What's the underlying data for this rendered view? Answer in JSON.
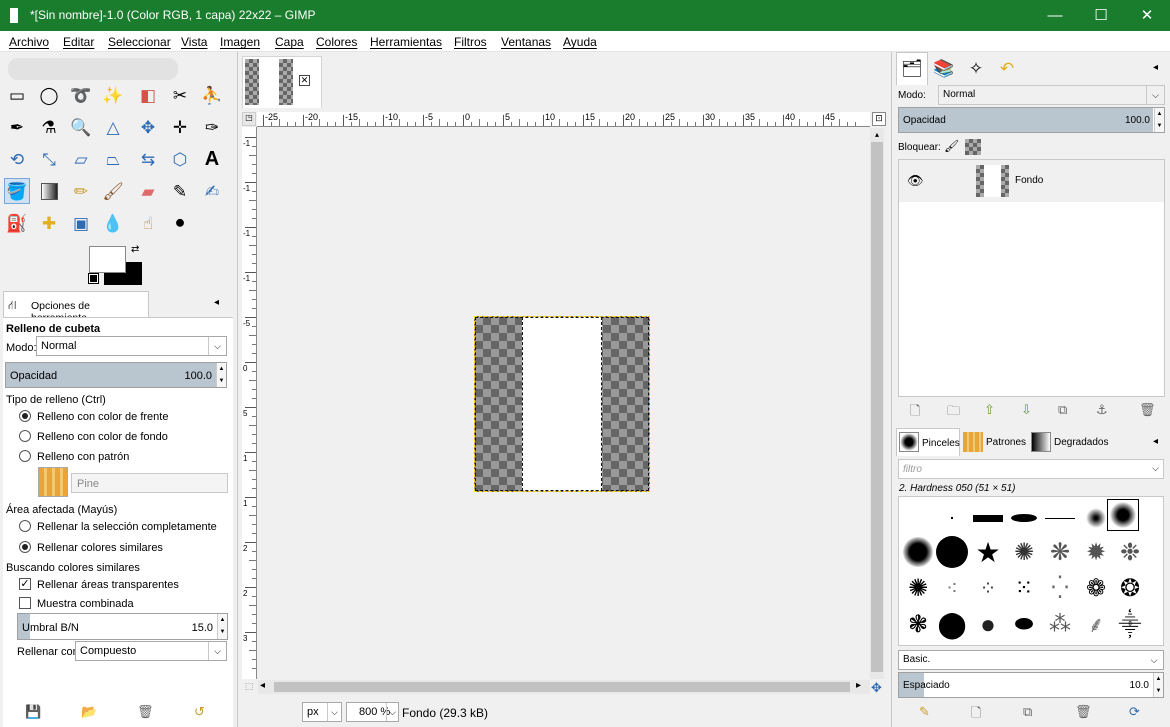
{
  "window": {
    "title": "*[Sin nombre]-1.0 (Color RGB, 1 capa) 22x22 – GIMP",
    "minimize_glyph": "—",
    "maximize_glyph": "☐",
    "close_glyph": "✕"
  },
  "menu": [
    "Archivo",
    "Editar",
    "Seleccionar",
    "Vista",
    "Imagen",
    "Capa",
    "Colores",
    "Herramientas",
    "Filtros",
    "Ventanas",
    "Ayuda"
  ],
  "tool_options": {
    "tab_label": "Opciones de herramienta",
    "tool_name": "Relleno de cubeta",
    "mode_label": "Modo:",
    "mode_value": "Normal",
    "opacity_label": "Opacidad",
    "opacity_value": "100.0",
    "opacity_fraction": 1.0,
    "fill_type_label": "Tipo de relleno  (Ctrl)",
    "fill_options": [
      "Relleno con color de frente",
      "Relleno con color de fondo",
      "Relleno con patrón"
    ],
    "fill_selected": 0,
    "pattern_name": "Pine",
    "area_label": "Área afectada  (Mayús)",
    "area_options": [
      "Rellenar la selección completamente",
      "Rellenar colores similares"
    ],
    "area_selected": 1,
    "finding_label": "Buscando colores similares",
    "transparent_label": "Rellenar áreas transparentes",
    "transparent_checked": true,
    "sample_merged_label": "Muestra combinada",
    "sample_merged_checked": false,
    "threshold_label": "Umbral B/N",
    "threshold_value": "15.0",
    "threshold_fraction": 0.06,
    "fill_by_label": "Rellenar con:",
    "fill_by_value": "Compuesto"
  },
  "ruler": {
    "h_labels": [
      "-25",
      "-20",
      "-15",
      "-10",
      "-5",
      "0",
      "5",
      "10",
      "15",
      "20",
      "25",
      "30",
      "35",
      "40",
      "45"
    ],
    "v_labels": [
      "-1",
      "-1",
      "-1",
      "-1",
      "-5",
      "0",
      "5",
      "1",
      "1",
      "2",
      "2",
      "3"
    ]
  },
  "status": {
    "unit": "px",
    "zoom": "800 %",
    "layer_info": "Fondo (29.3 kB)"
  },
  "layers": {
    "mode_label": "Modo:",
    "mode_value": "Normal",
    "opacity_label": "Opacidad",
    "opacity_value": "100.0",
    "opacity_fraction": 1.0,
    "lock_label": "Bloquear:",
    "layer_name": "Fondo"
  },
  "brushes": {
    "tabs": [
      "Pinceles",
      "Patrones",
      "Degradados"
    ],
    "filter_placeholder": "filtro",
    "brush_name": "2. Hardness 050 (51 × 51)",
    "tag_value": "Basic.",
    "spacing_label": "Espaciado",
    "spacing_value": "10.0",
    "spacing_fraction": 0.1
  },
  "colors": {
    "titlebar": "#1a7d2e",
    "foreground": "#ffffff",
    "background": "#000000"
  }
}
